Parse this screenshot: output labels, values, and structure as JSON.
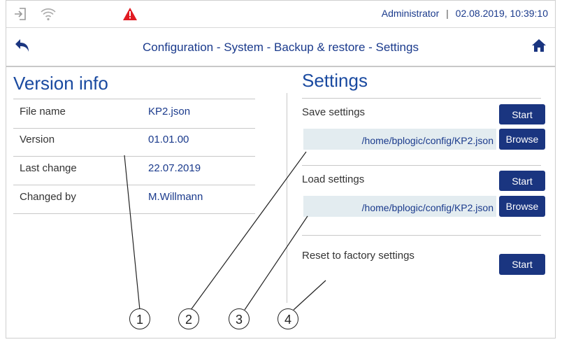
{
  "status": {
    "user": "Administrator",
    "separator": "|",
    "datetime": "02.08.2019, 10:39:10",
    "warning_color": "#e11b22"
  },
  "nav": {
    "title": "Configuration - System - Backup & restore - Settings"
  },
  "version_info": {
    "title": "Version info",
    "rows": [
      {
        "label": "File name",
        "value": "KP2.json"
      },
      {
        "label": "Version",
        "value": "01.01.00"
      },
      {
        "label": "Last change",
        "value": "22.07.2019"
      },
      {
        "label": "Changed by",
        "value": "M.Willmann"
      }
    ]
  },
  "settings": {
    "title": "Settings",
    "save": {
      "label": "Save settings",
      "start_label": "Start",
      "path": "/home/bplogic/config/KP2.json",
      "browse_label": "Browse"
    },
    "load": {
      "label": "Load settings",
      "start_label": "Start",
      "path": "/home/bplogic/config/KP2.json",
      "browse_label": "Browse"
    },
    "reset": {
      "label": "Reset to factory settings",
      "start_label": "Start"
    }
  },
  "callouts": [
    "1",
    "2",
    "3",
    "4"
  ],
  "colors": {
    "accent": "#1a3580",
    "text_blue": "#1a3a8c",
    "path_bg": "#e3ecf0"
  }
}
